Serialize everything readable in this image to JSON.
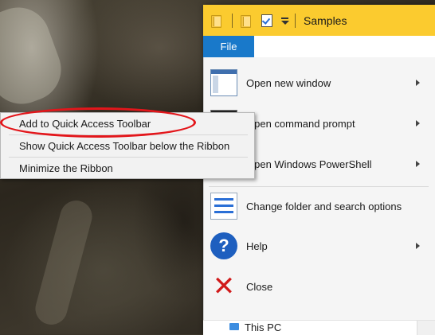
{
  "window": {
    "title": "Samples",
    "file_tab_label": "File"
  },
  "file_menu": {
    "items": [
      {
        "label": "Open new window",
        "has_submenu": true,
        "icon": "window-icon"
      },
      {
        "label": "Open command prompt",
        "has_submenu": true,
        "icon": "command-prompt-icon"
      },
      {
        "label": "Open Windows PowerShell",
        "has_submenu": true,
        "icon": "powershell-icon"
      },
      {
        "label": "Change folder and search options",
        "has_submenu": false,
        "icon": "folder-options-icon"
      },
      {
        "label": "Help",
        "has_submenu": true,
        "icon": "help-icon"
      },
      {
        "label": "Close",
        "has_submenu": false,
        "icon": "close-icon"
      }
    ]
  },
  "navigation": {
    "this_pc_label": "This PC"
  },
  "context_menu": {
    "items": [
      {
        "label": "Add to Quick Access Toolbar",
        "highlighted": true
      },
      {
        "label": "Show Quick Access Toolbar below the Ribbon"
      },
      {
        "label": "Minimize the Ribbon"
      }
    ]
  },
  "colors": {
    "title_bar": "#fbcb2f",
    "file_tab": "#1979ca",
    "highlight_ring": "#e3161b",
    "close_icon": "#d11a1a",
    "help_icon": "#1e5fbf"
  }
}
